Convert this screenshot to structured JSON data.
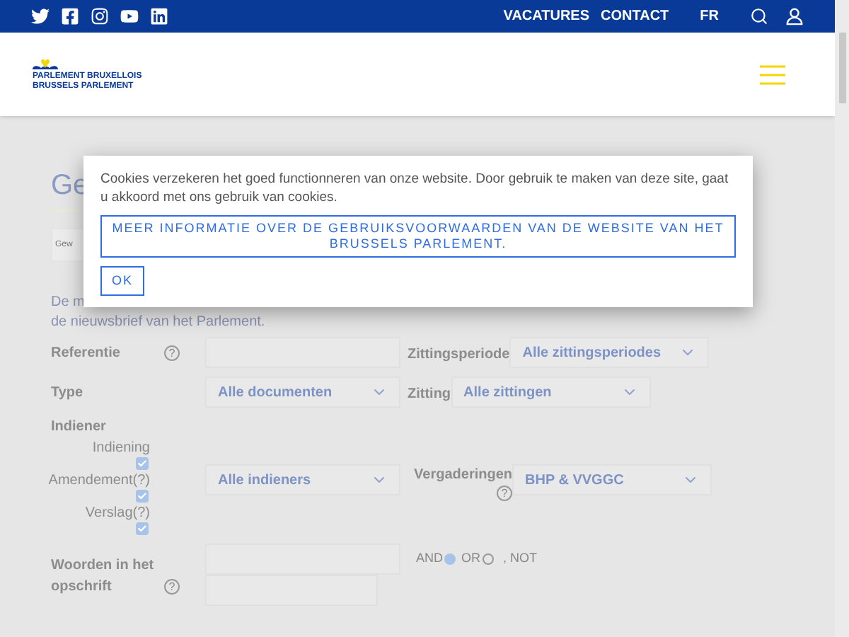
{
  "top_bar": {
    "nav_links": [
      "VACATURES",
      "CONTACT"
    ],
    "language": "FR"
  },
  "logo": {
    "lines": [
      "PARLEMENT BRUXELLOIS",
      "BRUSSELS PARLEMENT"
    ]
  },
  "page": {
    "title": "Ge",
    "search_placeholder": "Gew",
    "intro_lines": [
      "De m",
      "de nieuwsbrief van het Parlement."
    ]
  },
  "form": {
    "rows": [
      {
        "kind": "text",
        "label": "Referentie",
        "help": "?",
        "right_label": "Zittingsperiode",
        "right_value": "Alle zittingsperiodes"
      },
      {
        "kind": "select",
        "label": "Type",
        "value": "Alle documenten",
        "right_label": "Zitting",
        "right_value": "Alle zittingen"
      }
    ],
    "indiener": {
      "label": "Indiener",
      "options": [
        {
          "label": "Indiening",
          "checked": true
        },
        {
          "label": "Amendement(?)",
          "checked": true
        },
        {
          "label": "Verslag(?)",
          "checked": true
        }
      ],
      "value": "Alle indieners",
      "right_label": "Vergaderingen",
      "right_help": "?",
      "right_value": "BHP & VVGGC"
    },
    "words": {
      "label_lines": [
        "Woorden in het",
        "opschrift"
      ],
      "help": "?",
      "operators": [
        {
          "label": "AND",
          "selected": true
        },
        {
          "label": "OR",
          "selected": false
        }
      ],
      "suffix": ", NOT"
    }
  },
  "cookie_dialog": {
    "text": "Cookies verzekeren het goed functionneren van onze website. Door gebruik te maken van deze site, gaat u akkoord met ons gebruik van cookies.",
    "link": "MEER INFORMATIE OVER DE GEBRUIKSVOORWAARDEN VAN DE WEBSITE VAN HET BRUSSELS PARLEMENT.",
    "button": "OK"
  }
}
